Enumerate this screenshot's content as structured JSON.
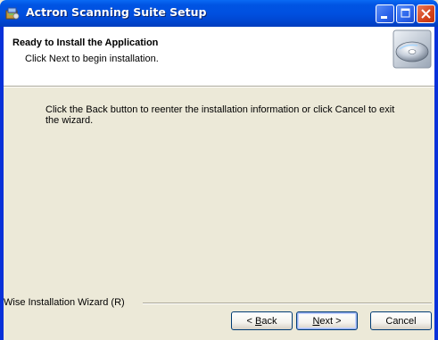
{
  "window": {
    "title": "Actron Scanning Suite Setup"
  },
  "header": {
    "title": "Ready to Install the Application",
    "subtitle": "Click Next to begin installation."
  },
  "body": {
    "text": "Click the Back button to reenter the installation information or click Cancel to exit the wizard."
  },
  "footer": {
    "label": "Wise Installation Wizard (R)"
  },
  "buttons": {
    "back_prefix": "< ",
    "back_mnemonic": "B",
    "back_rest": "ack",
    "next_mnemonic": "N",
    "next_rest": "ext >",
    "cancel": "Cancel"
  },
  "icons": {
    "app": "installer-icon",
    "header": "cd-disc-icon",
    "minimize": "minimize-icon",
    "maximize": "maximize-icon",
    "close": "close-icon"
  }
}
